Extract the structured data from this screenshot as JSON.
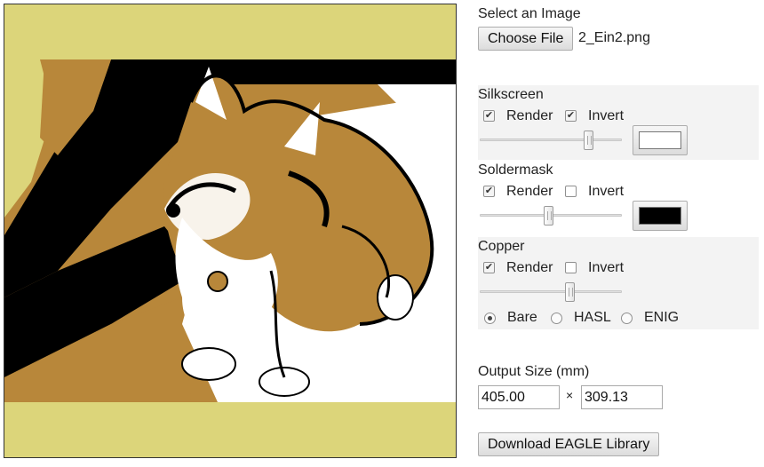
{
  "file": {
    "label": "Select an Image",
    "button_label": "Choose File",
    "filename": "2_Ein2.png"
  },
  "layers": [
    {
      "title": "Silkscreen",
      "render_label": "Render",
      "render_checked": true,
      "invert_label": "Invert",
      "invert_checked": true,
      "slider_value": 0.76,
      "color": "#ffffff"
    },
    {
      "title": "Soldermask",
      "render_label": "Render",
      "render_checked": true,
      "invert_label": "Invert",
      "invert_checked": false,
      "slider_value": 0.48,
      "color": "#000000"
    },
    {
      "title": "Copper",
      "render_label": "Render",
      "render_checked": true,
      "invert_label": "Invert",
      "invert_checked": false,
      "slider_value": 0.63
    }
  ],
  "finish": {
    "options": [
      "Bare",
      "HASL",
      "ENIG"
    ],
    "selected": "Bare"
  },
  "output": {
    "label": "Output Size (mm)",
    "width": "405.00",
    "separator": "×",
    "height": "309.13"
  },
  "download_label": "Download EAGLE Library",
  "preview_colors": {
    "board": "#dcd57a",
    "copper": "#b8873a",
    "silk": "#ffffff",
    "mask": "#000000"
  }
}
